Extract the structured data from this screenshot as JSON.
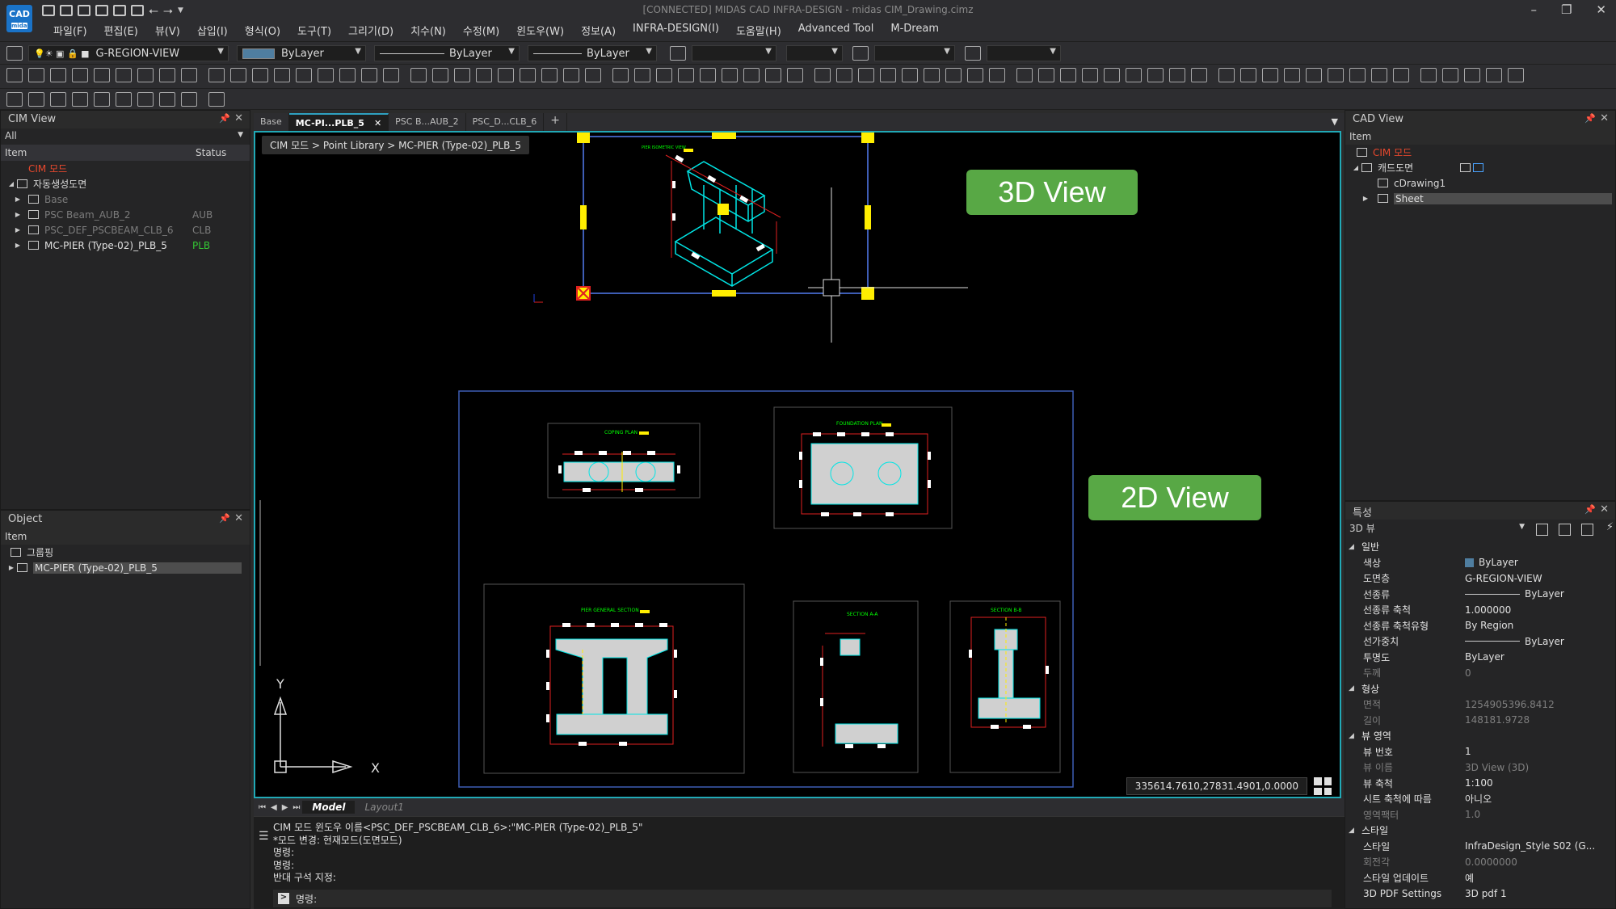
{
  "app": {
    "logo_text": "CAD",
    "logo_sub": "midas",
    "title": "[CONNECTED] MIDAS CAD INFRA-DESIGN - midas CIM_Drawing.cimz"
  },
  "menu": [
    "파일(F)",
    "편집(E)",
    "뷰(V)",
    "삽입(I)",
    "형식(O)",
    "도구(T)",
    "그리기(D)",
    "치수(N)",
    "수정(M)",
    "윈도우(W)",
    "정보(A)",
    "INFRA-DESIGN(I)",
    "도움말(H)",
    "Advanced Tool",
    "M-Dream"
  ],
  "toolbar": {
    "layer": "G-REGION-VIEW",
    "color": "ByLayer",
    "linetype": "ByLayer",
    "lineweight": "ByLayer"
  },
  "cim_view": {
    "title": "CIM View",
    "filter": "All",
    "col_item": "Item",
    "col_status": "Status",
    "root": "CIM 모드",
    "group": "자동생성도면",
    "items": [
      {
        "label": "Base",
        "status": ""
      },
      {
        "label": "PSC Beam_AUB_2",
        "status": "AUB"
      },
      {
        "label": "PSC_DEF_PSCBEAM_CLB_6",
        "status": "CLB"
      },
      {
        "label": "MC-PIER (Type-02)_PLB_5",
        "status": "PLB"
      }
    ]
  },
  "object_panel": {
    "title": "Object",
    "col_item": "Item",
    "group": "그룹핑",
    "selected": "MC-PIER (Type-02)_PLB_5"
  },
  "doc_tabs": [
    "Base",
    "MC-PI...PLB_5",
    "PSC B...AUB_2",
    "PSC_D...CLB_6",
    "+"
  ],
  "canvas": {
    "breadcrumb": "CIM 모드 > Point Library > MC-PIER (Type-02)_PLB_5",
    "badge_3d": "3D View",
    "badge_2d": "2D View",
    "axis_x": "X",
    "axis_y": "Y",
    "coordinates": "335614.7610,27831.4901,0.0000"
  },
  "layout_tabs": [
    "Model",
    "Layout1"
  ],
  "command": {
    "lines": [
      "CIM 모드 윈도우 이름<PSC_DEF_PSCBEAM_CLB_6>:\"MC-PIER (Type-02)_PLB_5\"",
      "*모드 변경: 현재모드(도면모드)",
      "명령:",
      "명령:",
      "반대 구석 지정:"
    ],
    "prompt": "명령:"
  },
  "cad_view": {
    "title": "CAD View",
    "col_item": "Item",
    "root": "CIM 모드",
    "sub": "캐드도면",
    "children": [
      "cDrawing1",
      "Sheet"
    ]
  },
  "properties": {
    "title": "특성",
    "selector": "3D 뷰",
    "sections": [
      {
        "name": "일반",
        "rows": [
          {
            "k": "색상",
            "v": "ByLayer",
            "swatch": true
          },
          {
            "k": "도면층",
            "v": "G-REGION-VIEW"
          },
          {
            "k": "선종류",
            "v": "ByLayer",
            "line": true
          },
          {
            "k": "선종류 축척",
            "v": "1.000000"
          },
          {
            "k": "선종류 축척유형",
            "v": "By Region"
          },
          {
            "k": "선가중치",
            "v": "ByLayer",
            "line": true
          },
          {
            "k": "투명도",
            "v": "ByLayer"
          },
          {
            "k": "두께",
            "v": "0",
            "dim": true
          }
        ]
      },
      {
        "name": "형상",
        "rows": [
          {
            "k": "면적",
            "v": "1254905396.8412",
            "dim": true
          },
          {
            "k": "길이",
            "v": "148181.9728",
            "dim": true
          }
        ]
      },
      {
        "name": "뷰 영역",
        "rows": [
          {
            "k": "뷰 번호",
            "v": "1"
          },
          {
            "k": "뷰 이름",
            "v": "3D View (3D)",
            "dim": true
          },
          {
            "k": "뷰 축척",
            "v": "1:100"
          },
          {
            "k": "시트 축척에 따름",
            "v": "아니오"
          },
          {
            "k": "영역팩터",
            "v": "1.0",
            "dim": true
          }
        ]
      },
      {
        "name": "스타일",
        "rows": [
          {
            "k": "스타일",
            "v": "InfraDesign_Style S02 (G..."
          },
          {
            "k": "회전각",
            "v": "0.0000000",
            "dim": true
          },
          {
            "k": "스타일 업데이트",
            "v": "예"
          },
          {
            "k": "3D PDF Settings",
            "v": "3D pdf 1"
          }
        ]
      }
    ]
  },
  "drawings": {
    "iso": "PIER ISOMETRIC VIEW",
    "coping": "COPING PLAN",
    "foundation": "FOUNDATION PLAN",
    "section": "PIER GENERAL SECTION",
    "sec_a": "SECTION A-A",
    "sec_b": "SECTION B-B"
  },
  "colors": {
    "accent": "#21a9b6",
    "badge": "#58a845",
    "cyan": "#00e5e5",
    "red": "#e02020",
    "yellow": "#ffee00",
    "frame_blue": "#3e5db5"
  }
}
